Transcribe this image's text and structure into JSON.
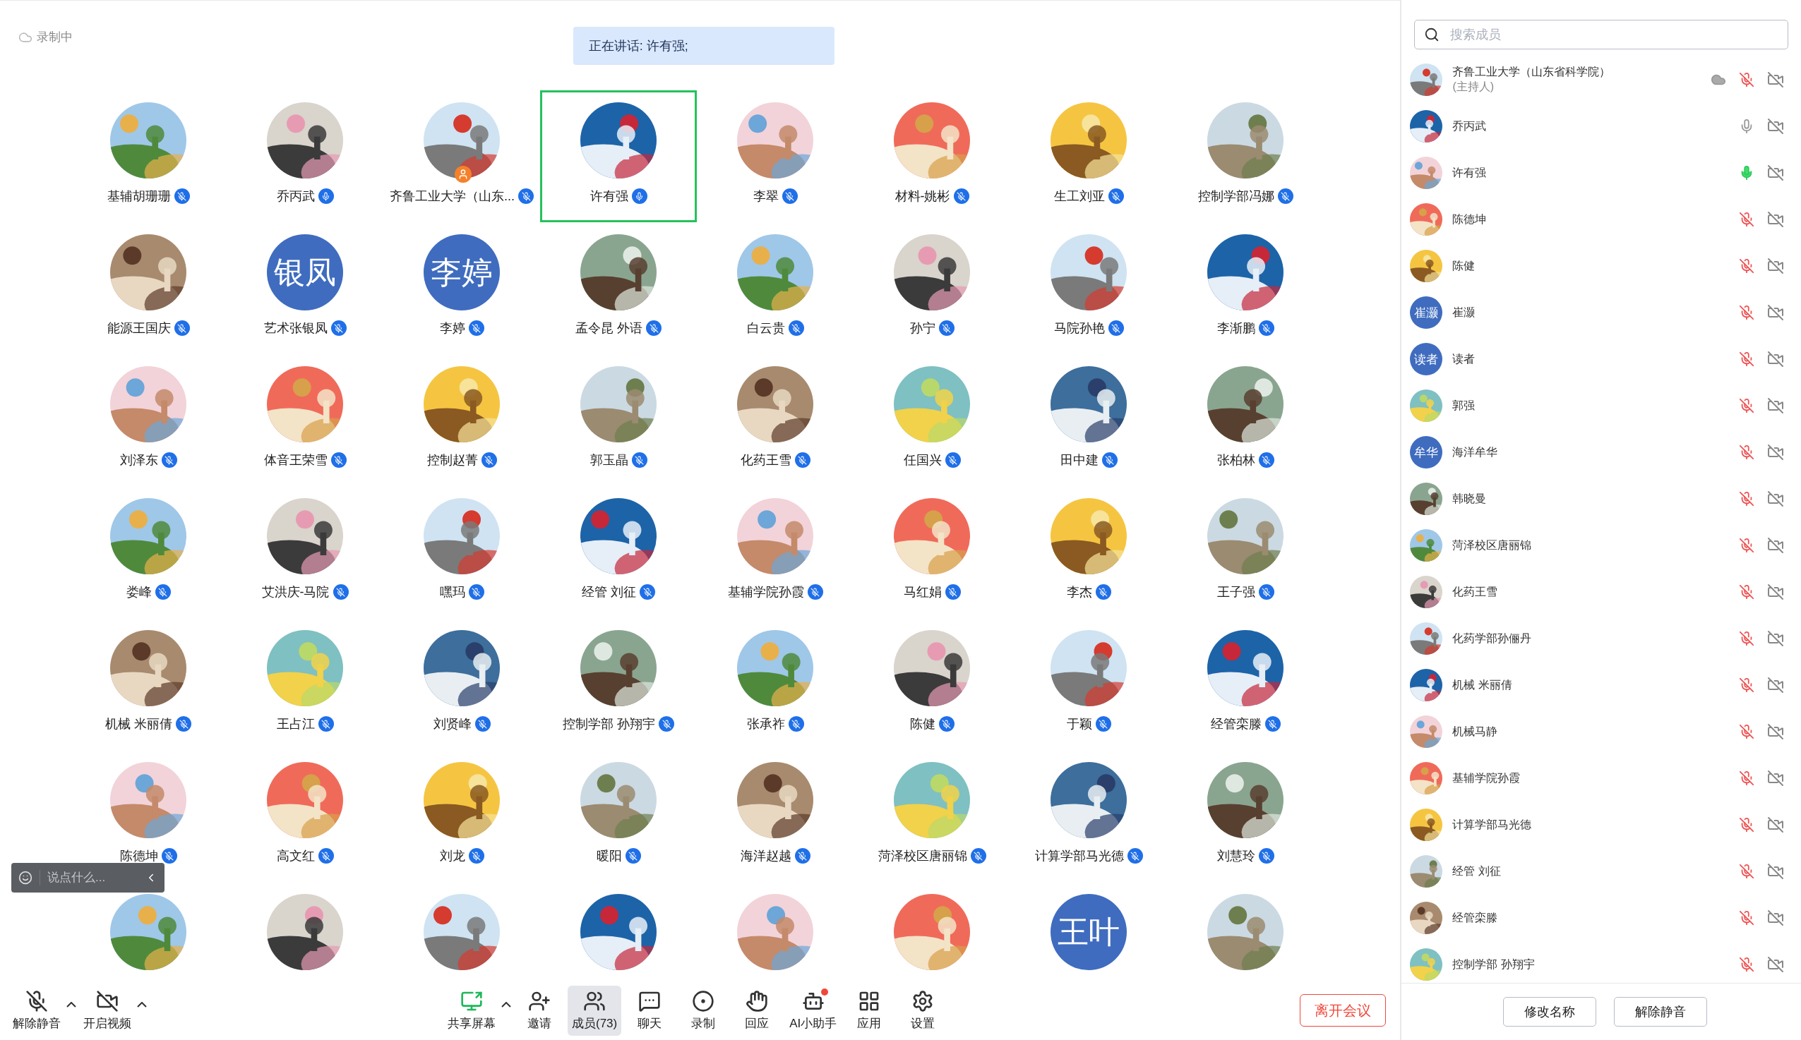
{
  "recording_badge": "录制中",
  "speaker_banner": "正在讲话: 许有强;",
  "tiles": [
    {
      "name": "基辅胡珊珊",
      "avatar": {
        "kind": "picture"
      },
      "muted": true,
      "speaking": false,
      "host": false
    },
    {
      "name": "乔丙武",
      "avatar": {
        "kind": "picture"
      },
      "muted": false,
      "speaking": false,
      "host": false
    },
    {
      "name": "齐鲁工业大学（山东...",
      "avatar": {
        "kind": "picture"
      },
      "muted": true,
      "speaking": false,
      "host": true
    },
    {
      "name": "许有强",
      "avatar": {
        "kind": "picture"
      },
      "muted": false,
      "speaking": true,
      "host": false
    },
    {
      "name": "李翠",
      "avatar": {
        "kind": "picture"
      },
      "muted": true,
      "speaking": false,
      "host": false
    },
    {
      "name": "材料-姚彬",
      "avatar": {
        "kind": "picture"
      },
      "muted": true,
      "speaking": false,
      "host": false
    },
    {
      "name": "生工刘亚",
      "avatar": {
        "kind": "picture"
      },
      "muted": true,
      "speaking": false,
      "host": false
    },
    {
      "name": "控制学部冯娜",
      "avatar": {
        "kind": "picture"
      },
      "muted": true,
      "speaking": false,
      "host": false
    },
    {
      "name": "能源王国庆",
      "avatar": {
        "kind": "picture"
      },
      "muted": true,
      "speaking": false,
      "host": false
    },
    {
      "name": "艺术张银凤",
      "avatar": {
        "kind": "text",
        "text": "银凤"
      },
      "muted": true,
      "speaking": false,
      "host": false
    },
    {
      "name": "李婷",
      "avatar": {
        "kind": "text",
        "text": "李婷"
      },
      "muted": true,
      "speaking": false,
      "host": false
    },
    {
      "name": "孟令昆 外语",
      "avatar": {
        "kind": "picture"
      },
      "muted": true,
      "speaking": false,
      "host": false
    },
    {
      "name": "白云贵",
      "avatar": {
        "kind": "picture"
      },
      "muted": true,
      "speaking": false,
      "host": false
    },
    {
      "name": "孙宁",
      "avatar": {
        "kind": "picture"
      },
      "muted": true,
      "speaking": false,
      "host": false
    },
    {
      "name": "马院孙艳",
      "avatar": {
        "kind": "picture"
      },
      "muted": true,
      "speaking": false,
      "host": false
    },
    {
      "name": "李渐鹏",
      "avatar": {
        "kind": "picture"
      },
      "muted": true,
      "speaking": false,
      "host": false
    },
    {
      "name": "刘泽东",
      "avatar": {
        "kind": "picture"
      },
      "muted": true,
      "speaking": false,
      "host": false
    },
    {
      "name": "体音王荣雪",
      "avatar": {
        "kind": "picture"
      },
      "muted": true,
      "speaking": false,
      "host": false
    },
    {
      "name": "控制赵菁",
      "avatar": {
        "kind": "picture"
      },
      "muted": true,
      "speaking": false,
      "host": false
    },
    {
      "name": "郭玉晶",
      "avatar": {
        "kind": "picture"
      },
      "muted": true,
      "speaking": false,
      "host": false
    },
    {
      "name": "化药王雪",
      "avatar": {
        "kind": "picture"
      },
      "muted": true,
      "speaking": false,
      "host": false
    },
    {
      "name": "任国兴",
      "avatar": {
        "kind": "picture"
      },
      "muted": true,
      "speaking": false,
      "host": false
    },
    {
      "name": "田中建",
      "avatar": {
        "kind": "picture"
      },
      "muted": true,
      "speaking": false,
      "host": false
    },
    {
      "name": "张柏林",
      "avatar": {
        "kind": "picture"
      },
      "muted": true,
      "speaking": false,
      "host": false
    },
    {
      "name": "娄峰",
      "avatar": {
        "kind": "picture"
      },
      "muted": true,
      "speaking": false,
      "host": false
    },
    {
      "name": "艾洪庆-马院",
      "avatar": {
        "kind": "picture"
      },
      "muted": true,
      "speaking": false,
      "host": false
    },
    {
      "name": "嘿玛",
      "avatar": {
        "kind": "picture"
      },
      "muted": true,
      "speaking": false,
      "host": false
    },
    {
      "name": "经管 刘征",
      "avatar": {
        "kind": "picture"
      },
      "muted": true,
      "speaking": false,
      "host": false
    },
    {
      "name": "基辅学院孙霞",
      "avatar": {
        "kind": "picture"
      },
      "muted": true,
      "speaking": false,
      "host": false
    },
    {
      "name": "马红娟",
      "avatar": {
        "kind": "picture"
      },
      "muted": true,
      "speaking": false,
      "host": false
    },
    {
      "name": "李杰",
      "avatar": {
        "kind": "picture"
      },
      "muted": true,
      "speaking": false,
      "host": false
    },
    {
      "name": "王子强",
      "avatar": {
        "kind": "picture"
      },
      "muted": true,
      "speaking": false,
      "host": false
    },
    {
      "name": "机械 米丽倩",
      "avatar": {
        "kind": "picture"
      },
      "muted": true,
      "speaking": false,
      "host": false
    },
    {
      "name": "王占江",
      "avatar": {
        "kind": "picture"
      },
      "muted": true,
      "speaking": false,
      "host": false
    },
    {
      "name": "刘贤峰",
      "avatar": {
        "kind": "picture"
      },
      "muted": true,
      "speaking": false,
      "host": false
    },
    {
      "name": "控制学部 孙翔宇",
      "avatar": {
        "kind": "picture"
      },
      "muted": true,
      "speaking": false,
      "host": false
    },
    {
      "name": "张承祚",
      "avatar": {
        "kind": "picture"
      },
      "muted": true,
      "speaking": false,
      "host": false
    },
    {
      "name": "陈健",
      "avatar": {
        "kind": "picture"
      },
      "muted": true,
      "speaking": false,
      "host": false
    },
    {
      "name": "于颖",
      "avatar": {
        "kind": "picture"
      },
      "muted": true,
      "speaking": false,
      "host": false
    },
    {
      "name": "经管栾滕",
      "avatar": {
        "kind": "picture"
      },
      "muted": true,
      "speaking": false,
      "host": false
    },
    {
      "name": "陈德坤",
      "avatar": {
        "kind": "picture"
      },
      "muted": true,
      "speaking": false,
      "host": false
    },
    {
      "name": "高文红",
      "avatar": {
        "kind": "picture"
      },
      "muted": true,
      "speaking": false,
      "host": false
    },
    {
      "name": "刘龙",
      "avatar": {
        "kind": "picture"
      },
      "muted": true,
      "speaking": false,
      "host": false
    },
    {
      "name": "暖阳",
      "avatar": {
        "kind": "picture"
      },
      "muted": true,
      "speaking": false,
      "host": false
    },
    {
      "name": "海洋赵越",
      "avatar": {
        "kind": "picture"
      },
      "muted": true,
      "speaking": false,
      "host": false
    },
    {
      "name": "菏泽校区唐丽锦",
      "avatar": {
        "kind": "picture"
      },
      "muted": true,
      "speaking": false,
      "host": false
    },
    {
      "name": "计算学部马光德",
      "avatar": {
        "kind": "picture"
      },
      "muted": true,
      "speaking": false,
      "host": false
    },
    {
      "name": "刘慧玲",
      "avatar": {
        "kind": "picture"
      },
      "muted": true,
      "speaking": false,
      "host": false
    },
    {
      "avatar": {
        "kind": "picture"
      }
    },
    {
      "avatar": {
        "kind": "picture"
      }
    },
    {
      "avatar": {
        "kind": "picture"
      }
    },
    {
      "avatar": {
        "kind": "picture"
      }
    },
    {
      "avatar": {
        "kind": "picture"
      }
    },
    {
      "avatar": {
        "kind": "picture"
      }
    },
    {
      "avatar": {
        "kind": "text",
        "text": "王叶"
      }
    },
    {
      "avatar": {
        "kind": "picture"
      }
    }
  ],
  "chat_input": {
    "placeholder": "说点什么..."
  },
  "toolbar": {
    "items": [
      {
        "label": "解除静音",
        "kind": "mic",
        "caret": true,
        "selected": false
      },
      {
        "label": "开启视频",
        "kind": "video",
        "caret": true,
        "selected": false
      },
      {
        "label": "共享屏幕",
        "kind": "share",
        "caret": true,
        "selected": false
      },
      {
        "label": "邀请",
        "kind": "invite",
        "caret": false,
        "selected": false
      },
      {
        "label": "成员(73)",
        "kind": "members",
        "caret": false,
        "selected": true
      },
      {
        "label": "聊天",
        "kind": "chat",
        "caret": false,
        "selected": false
      },
      {
        "label": "录制",
        "kind": "record",
        "caret": false,
        "selected": false
      },
      {
        "label": "回应",
        "kind": "react",
        "caret": false,
        "selected": false
      },
      {
        "label": "AI小助手",
        "kind": "assistant",
        "caret": false,
        "selected": false,
        "notification": true
      },
      {
        "label": "应用",
        "kind": "apps",
        "caret": false,
        "selected": false
      },
      {
        "label": "设置",
        "kind": "settings",
        "caret": false,
        "selected": false
      }
    ],
    "leave_button": "离开会议"
  },
  "sidebar": {
    "search": {
      "placeholder": "搜索成员"
    },
    "members": [
      {
        "name": "齐鲁工业大学（山东省科学院）",
        "role": "(主持人)",
        "avatar": {
          "kind": "picture"
        },
        "muted": true,
        "speaking": false,
        "camera_on": false,
        "recording": true
      },
      {
        "name": "乔丙武",
        "avatar": {
          "kind": "picture"
        },
        "muted": false,
        "speaking": false,
        "camera_on": false,
        "recording": false
      },
      {
        "name": "许有强",
        "avatar": {
          "kind": "picture"
        },
        "muted": false,
        "speaking": true,
        "camera_on": false,
        "recording": false
      },
      {
        "name": "陈德坤",
        "avatar": {
          "kind": "picture"
        },
        "muted": true,
        "speaking": false,
        "camera_on": false,
        "recording": false
      },
      {
        "name": "陈健",
        "avatar": {
          "kind": "picture"
        },
        "muted": true,
        "speaking": false,
        "camera_on": false,
        "recording": false
      },
      {
        "name": "崔灏",
        "avatar": {
          "kind": "text",
          "text": "崔灏"
        },
        "muted": true,
        "speaking": false,
        "camera_on": false,
        "recording": false
      },
      {
        "name": "读者",
        "avatar": {
          "kind": "text",
          "text": "读者"
        },
        "muted": true,
        "speaking": false,
        "camera_on": false,
        "recording": false
      },
      {
        "name": "郭强",
        "avatar": {
          "kind": "picture"
        },
        "muted": true,
        "speaking": false,
        "camera_on": false,
        "recording": false
      },
      {
        "name": "海洋牟华",
        "avatar": {
          "kind": "text",
          "text": "牟华"
        },
        "muted": true,
        "speaking": false,
        "camera_on": false,
        "recording": false
      },
      {
        "name": "韩晓曼",
        "avatar": {
          "kind": "picture"
        },
        "muted": true,
        "speaking": false,
        "camera_on": false,
        "recording": false
      },
      {
        "name": "菏泽校区唐丽锦",
        "avatar": {
          "kind": "picture"
        },
        "muted": true,
        "speaking": false,
        "camera_on": false,
        "recording": false
      },
      {
        "name": "化药王雪",
        "avatar": {
          "kind": "picture"
        },
        "muted": true,
        "speaking": false,
        "camera_on": false,
        "recording": false
      },
      {
        "name": "化药学部孙俪丹",
        "avatar": {
          "kind": "picture"
        },
        "muted": true,
        "speaking": false,
        "camera_on": false,
        "recording": false
      },
      {
        "name": "机械 米丽倩",
        "avatar": {
          "kind": "picture"
        },
        "muted": true,
        "speaking": false,
        "camera_on": false,
        "recording": false
      },
      {
        "name": "机械马静",
        "avatar": {
          "kind": "picture"
        },
        "muted": true,
        "speaking": false,
        "camera_on": false,
        "recording": false
      },
      {
        "name": "基辅学院孙霞",
        "avatar": {
          "kind": "picture"
        },
        "muted": true,
        "speaking": false,
        "camera_on": false,
        "recording": false
      },
      {
        "name": "计算学部马光德",
        "avatar": {
          "kind": "picture"
        },
        "muted": true,
        "speaking": false,
        "camera_on": false,
        "recording": false
      },
      {
        "name": "经管 刘征",
        "avatar": {
          "kind": "picture"
        },
        "muted": true,
        "speaking": false,
        "camera_on": false,
        "recording": false
      },
      {
        "name": "经管栾滕",
        "avatar": {
          "kind": "picture"
        },
        "muted": true,
        "speaking": false,
        "camera_on": false,
        "recording": false
      },
      {
        "name": "控制学部 孙翔宇",
        "avatar": {
          "kind": "picture"
        },
        "muted": true,
        "speaking": false,
        "camera_on": false,
        "recording": false
      }
    ],
    "buttons": [
      "修改名称",
      "解除静音"
    ]
  }
}
